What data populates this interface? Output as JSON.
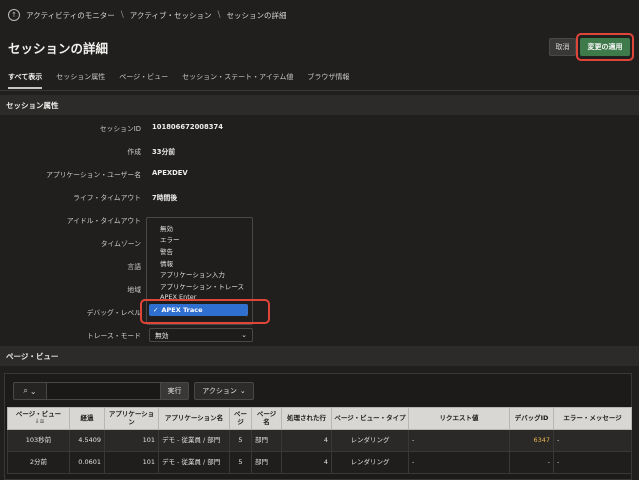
{
  "breadcrumb": {
    "items": [
      "アクティビティのモニター",
      "アクティブ・セッション",
      "セッションの詳細"
    ]
  },
  "header": {
    "title": "セッションの詳細",
    "cancel_label": "取消",
    "apply_label": "変更の適用"
  },
  "tabs": [
    {
      "label": "すべて表示",
      "active": true
    },
    {
      "label": "セッション属性"
    },
    {
      "label": "ページ・ビュー"
    },
    {
      "label": "セッション・ステート・アイテム値"
    },
    {
      "label": "ブラウザ情報"
    }
  ],
  "session_attributes": {
    "heading": "セッション属性",
    "rows": [
      {
        "label": "セッションID",
        "value": "101806672008374"
      },
      {
        "label": "作成",
        "value": "33分前"
      },
      {
        "label": "アプリケーション・ユーザー名",
        "value": "APEXDEV"
      },
      {
        "label": "ライフ・タイムアウト",
        "value": "7時間後"
      },
      {
        "label": "アイドル・タイムアウト",
        "value": ""
      },
      {
        "label": "タイムゾーン",
        "value": ""
      },
      {
        "label": "言語",
        "value": ""
      },
      {
        "label": "地域",
        "value": ""
      },
      {
        "label": "デバッグ・レベル",
        "value": ""
      },
      {
        "label": "トレース・モード",
        "value": ""
      }
    ],
    "debug_level_options": [
      "無効",
      "エラー",
      "警告",
      "情報",
      "アプリケーション入力",
      "アプリケーション・トレース",
      "APEX Enter",
      "APEX Trace"
    ],
    "debug_level_selected": "APEX Trace",
    "trace_mode_value": "無効"
  },
  "page_views": {
    "heading": "ページ・ビュー",
    "search_value": "",
    "run_label": "実行",
    "actions_label": "アクション",
    "columns": [
      "ページ・ビュー",
      "経過",
      "アプリケーション",
      "アプリケーション名",
      "ページ",
      "ページ名",
      "処理された行",
      "ページ・ビュー・タイプ",
      "リクエスト値",
      "デバッグID",
      "エラー・メッセージ"
    ],
    "rows": [
      [
        "103秒前",
        "4.5409",
        "101",
        "デモ - 従業員 / 部門",
        "5",
        "部門",
        "4",
        "レンダリング",
        "-",
        "6347",
        "-"
      ],
      [
        "2分前",
        "0.0601",
        "101",
        "デモ - 従業員 / 部門",
        "5",
        "部門",
        "4",
        "レンダリング",
        "-",
        "-",
        "-"
      ]
    ]
  }
}
